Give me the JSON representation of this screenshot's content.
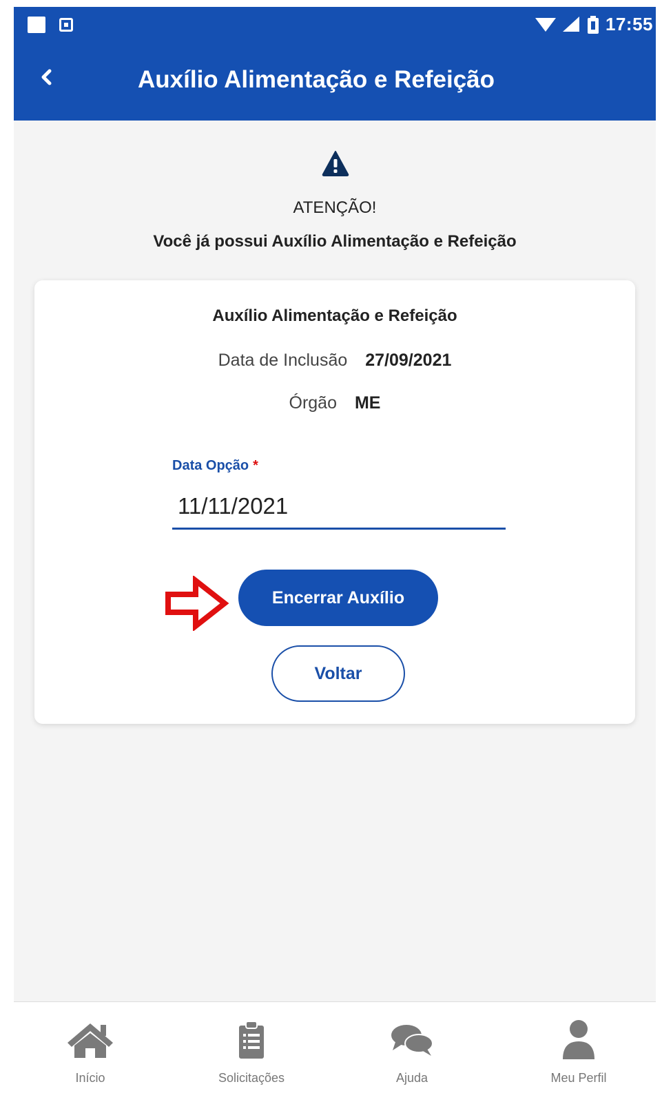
{
  "status_bar": {
    "time": "17:55"
  },
  "app_bar": {
    "title": "Auxílio Alimentação e Refeição"
  },
  "warning": {
    "heading": "ATENÇÃO!",
    "message": "Você já possui Auxílio Alimentação e Refeição"
  },
  "card": {
    "title": "Auxílio Alimentação e Refeição",
    "inclusion_label": "Data de Inclusão",
    "inclusion_value": "27/09/2021",
    "organ_label": "Órgão",
    "organ_value": "ME",
    "option_date_label": "Data Opção",
    "option_date_required": "*",
    "option_date_value": "11/11/2021",
    "end_button": "Encerrar Auxílio",
    "back_button": "Voltar"
  },
  "bottom_nav": [
    {
      "label": "Início",
      "icon": "home-icon"
    },
    {
      "label": "Solicitações",
      "icon": "clipboard-icon"
    },
    {
      "label": "Ajuda",
      "icon": "chat-icon"
    },
    {
      "label": "Meu Perfil",
      "icon": "user-icon"
    }
  ],
  "colors": {
    "primary": "#1550b2",
    "background": "#f4f4f4",
    "annotation_arrow": "#e01010"
  }
}
